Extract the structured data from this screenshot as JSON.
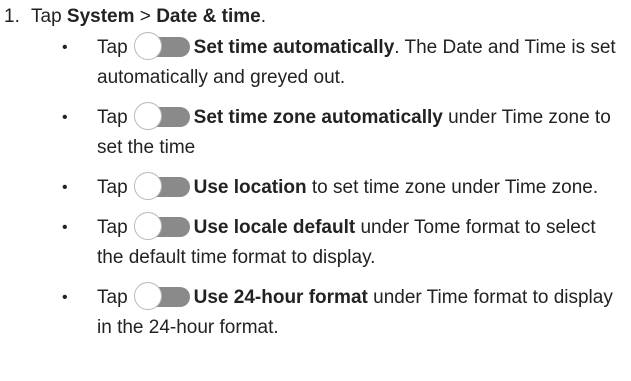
{
  "step": {
    "number": "1.",
    "prefix": "Tap ",
    "menu_system": "System",
    "separator": " > ",
    "menu_date_time": "Date & time",
    "suffix": "."
  },
  "bullets": [
    {
      "tap": "Tap",
      "toggle_icon": "toggle-switch-icon",
      "setting": "Set time automatically",
      "description": ". The Date and Time is set automatically and greyed out."
    },
    {
      "tap": "Tap",
      "toggle_icon": "toggle-switch-icon",
      "setting": "Set time zone automatically",
      "description": " under Time zone to set the time"
    },
    {
      "tap": "Tap",
      "toggle_icon": "toggle-switch-icon",
      "setting": "Use location",
      "description": " to set time zone under Time zone."
    },
    {
      "tap": "Tap",
      "toggle_icon": "toggle-switch-icon",
      "setting": "Use locale default",
      "description": " under Tome format to select the default time format to display."
    },
    {
      "tap": "Tap",
      "toggle_icon": "toggle-switch-icon",
      "setting": "Use 24-hour format",
      "description": " under Time format to display in the 24-hour format."
    }
  ],
  "colors": {
    "text": "#222222",
    "toggle_track": "#8a8a8a",
    "toggle_knob": "#ffffff"
  }
}
